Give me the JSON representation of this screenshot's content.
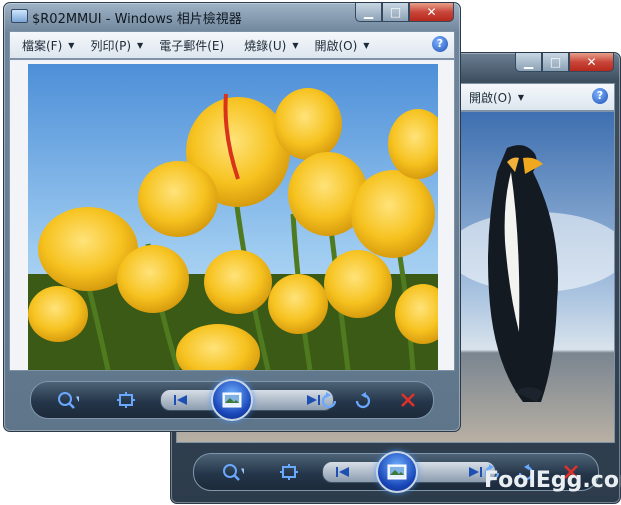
{
  "front_window": {
    "title": "$R02MMUI - Windows 相片檢視器",
    "menu": [
      {
        "label": "檔案(F)"
      },
      {
        "label": "列印(P)"
      },
      {
        "label": "電子郵件(E)"
      },
      {
        "label": "燒錄(U)"
      },
      {
        "label": "開啟(O)"
      }
    ],
    "photo_subject": "yellow tulips"
  },
  "back_window": {
    "menu": [
      {
        "label": "開啟(O)"
      }
    ],
    "photo_subject": "king penguin"
  },
  "icons": {
    "zoom": "zoom-magnifier-icon",
    "fit": "actual-size-icon",
    "prev": "previous-icon",
    "slideshow": "slideshow-icon",
    "next": "next-icon",
    "rotate_ccw": "rotate-counterclockwise-icon",
    "rotate_cw": "rotate-clockwise-icon",
    "delete": "delete-icon",
    "help": "help-icon"
  },
  "colors": {
    "delete_red": "#e0302a",
    "glass_blue": "#1e4fb3"
  },
  "watermark": "FoolEgg.com"
}
